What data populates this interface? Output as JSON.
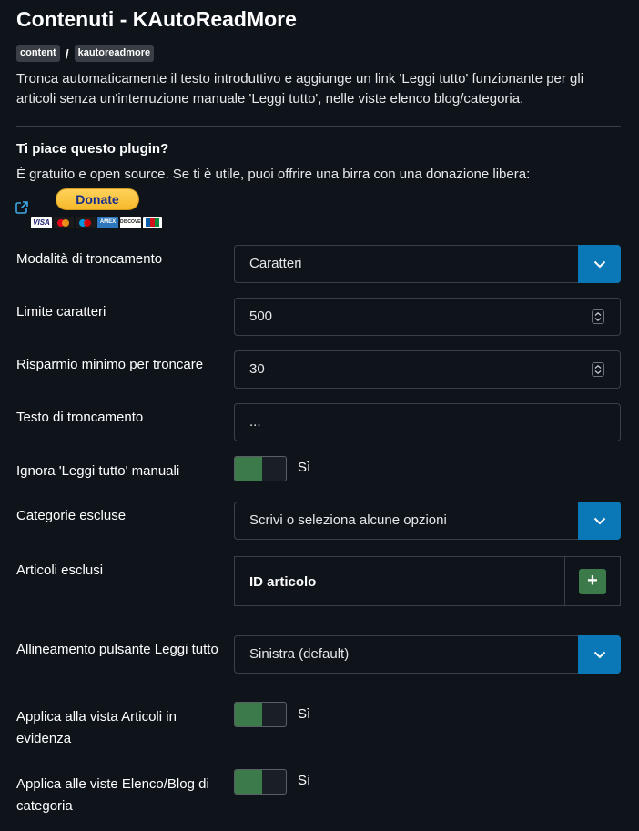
{
  "header": {
    "title": "Contenuti - KAutoReadMore",
    "breadcrumbs": [
      "content",
      "kautoreadmore"
    ],
    "breadcrumb_separator": "/",
    "description": "Tronca automaticamente il testo introduttivo e aggiunge un link 'Leggi tutto' funzionante per gli articoli senza un'interruzione manuale 'Leggi tutto', nelle viste elenco blog/categoria."
  },
  "plugin": {
    "question": "Ti piace questo plugin?",
    "text": "È gratuito e open source. Se ti è utile, puoi offrire una birra con una donazione libera:",
    "donate_label": "Donate",
    "external_link_icon": "external-link-icon",
    "cards": [
      "VISA",
      "mastercard",
      "maestro",
      "AMEX",
      "DISCOVER",
      "JCB"
    ]
  },
  "fields": {
    "truncation_mode": {
      "label": "Modalità di troncamento",
      "value": "Caratteri"
    },
    "char_limit": {
      "label": "Limite caratteri",
      "value": "500"
    },
    "min_saving": {
      "label": "Risparmio minimo per troncare",
      "value": "30"
    },
    "truncation_text": {
      "label": "Testo di troncamento",
      "value": "..."
    },
    "ignore_manual": {
      "label": "Ignora 'Leggi tutto' manuali",
      "state": "Sì"
    },
    "excluded_categories": {
      "label": "Categorie escluse",
      "placeholder": "Scrivi o seleziona alcune opzioni"
    },
    "excluded_articles": {
      "label": "Articoli esclusi",
      "column": "ID articolo",
      "add_label": "+"
    },
    "button_alignment": {
      "label": "Allineamento pulsante Leggi tutto",
      "value": "Sinistra (default)"
    },
    "featured_view": {
      "label": "Applica alla vista Articoli in evidenza",
      "state": "Sì"
    },
    "category_views": {
      "label": "Applica alle viste Elenco/Blog di categoria",
      "state": "Sì"
    }
  },
  "colors": {
    "background": "#0f141b",
    "select_button": "#0a77b6",
    "toggle_on": "#3c7a4a",
    "border": "#3b4048"
  }
}
